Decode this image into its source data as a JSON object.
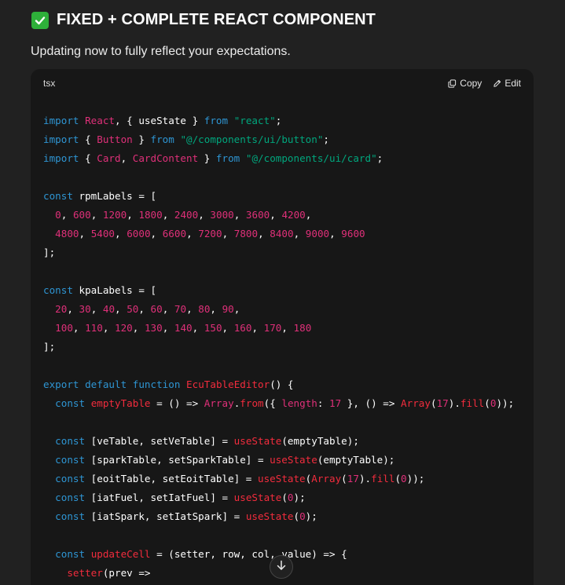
{
  "heading": {
    "emoji": "✅",
    "text": "FIXED + COMPLETE REACT COMPONENT"
  },
  "subtitle": "Updating now to fully reflect your expectations.",
  "code_block": {
    "language": "tsx",
    "copy_label": "Copy",
    "edit_label": "Edit",
    "lines": [
      [
        [
          "kw",
          "import"
        ],
        [
          "plain",
          " "
        ],
        [
          "id",
          "React"
        ],
        [
          "plain",
          ", { useState } "
        ],
        [
          "kw",
          "from"
        ],
        [
          "plain",
          " "
        ],
        [
          "str",
          "\"react\""
        ],
        [
          "plain",
          ";"
        ]
      ],
      [
        [
          "kw",
          "import"
        ],
        [
          "plain",
          " { "
        ],
        [
          "id",
          "Button"
        ],
        [
          "plain",
          " } "
        ],
        [
          "kw",
          "from"
        ],
        [
          "plain",
          " "
        ],
        [
          "str",
          "\"@/components/ui/button\""
        ],
        [
          "plain",
          ";"
        ]
      ],
      [
        [
          "kw",
          "import"
        ],
        [
          "plain",
          " { "
        ],
        [
          "id",
          "Card"
        ],
        [
          "plain",
          ", "
        ],
        [
          "id",
          "CardContent"
        ],
        [
          "plain",
          " } "
        ],
        [
          "kw",
          "from"
        ],
        [
          "plain",
          " "
        ],
        [
          "str",
          "\"@/components/ui/card\""
        ],
        [
          "plain",
          ";"
        ]
      ],
      [],
      [
        [
          "kw",
          "const"
        ],
        [
          "plain",
          " rpmLabels = ["
        ]
      ],
      [
        [
          "plain",
          "  "
        ],
        [
          "num",
          "0"
        ],
        [
          "plain",
          ", "
        ],
        [
          "num",
          "600"
        ],
        [
          "plain",
          ", "
        ],
        [
          "num",
          "1200"
        ],
        [
          "plain",
          ", "
        ],
        [
          "num",
          "1800"
        ],
        [
          "plain",
          ", "
        ],
        [
          "num",
          "2400"
        ],
        [
          "plain",
          ", "
        ],
        [
          "num",
          "3000"
        ],
        [
          "plain",
          ", "
        ],
        [
          "num",
          "3600"
        ],
        [
          "plain",
          ", "
        ],
        [
          "num",
          "4200"
        ],
        [
          "plain",
          ","
        ]
      ],
      [
        [
          "plain",
          "  "
        ],
        [
          "num",
          "4800"
        ],
        [
          "plain",
          ", "
        ],
        [
          "num",
          "5400"
        ],
        [
          "plain",
          ", "
        ],
        [
          "num",
          "6000"
        ],
        [
          "plain",
          ", "
        ],
        [
          "num",
          "6600"
        ],
        [
          "plain",
          ", "
        ],
        [
          "num",
          "7200"
        ],
        [
          "plain",
          ", "
        ],
        [
          "num",
          "7800"
        ],
        [
          "plain",
          ", "
        ],
        [
          "num",
          "8400"
        ],
        [
          "plain",
          ", "
        ],
        [
          "num",
          "9000"
        ],
        [
          "plain",
          ", "
        ],
        [
          "num",
          "9600"
        ]
      ],
      [
        [
          "plain",
          "];"
        ]
      ],
      [],
      [
        [
          "kw",
          "const"
        ],
        [
          "plain",
          " kpaLabels = ["
        ]
      ],
      [
        [
          "plain",
          "  "
        ],
        [
          "num",
          "20"
        ],
        [
          "plain",
          ", "
        ],
        [
          "num",
          "30"
        ],
        [
          "plain",
          ", "
        ],
        [
          "num",
          "40"
        ],
        [
          "plain",
          ", "
        ],
        [
          "num",
          "50"
        ],
        [
          "plain",
          ", "
        ],
        [
          "num",
          "60"
        ],
        [
          "plain",
          ", "
        ],
        [
          "num",
          "70"
        ],
        [
          "plain",
          ", "
        ],
        [
          "num",
          "80"
        ],
        [
          "plain",
          ", "
        ],
        [
          "num",
          "90"
        ],
        [
          "plain",
          ","
        ]
      ],
      [
        [
          "plain",
          "  "
        ],
        [
          "num",
          "100"
        ],
        [
          "plain",
          ", "
        ],
        [
          "num",
          "110"
        ],
        [
          "plain",
          ", "
        ],
        [
          "num",
          "120"
        ],
        [
          "plain",
          ", "
        ],
        [
          "num",
          "130"
        ],
        [
          "plain",
          ", "
        ],
        [
          "num",
          "140"
        ],
        [
          "plain",
          ", "
        ],
        [
          "num",
          "150"
        ],
        [
          "plain",
          ", "
        ],
        [
          "num",
          "160"
        ],
        [
          "plain",
          ", "
        ],
        [
          "num",
          "170"
        ],
        [
          "plain",
          ", "
        ],
        [
          "num",
          "180"
        ]
      ],
      [
        [
          "plain",
          "];"
        ]
      ],
      [],
      [
        [
          "kw",
          "export"
        ],
        [
          "plain",
          " "
        ],
        [
          "kw",
          "default"
        ],
        [
          "plain",
          " "
        ],
        [
          "kw",
          "function"
        ],
        [
          "plain",
          " "
        ],
        [
          "fn",
          "EcuTableEditor"
        ],
        [
          "plain",
          "() {"
        ]
      ],
      [
        [
          "plain",
          "  "
        ],
        [
          "kw",
          "const"
        ],
        [
          "plain",
          " "
        ],
        [
          "fn",
          "emptyTable"
        ],
        [
          "plain",
          " = () => "
        ],
        [
          "id",
          "Array"
        ],
        [
          "plain",
          "."
        ],
        [
          "fn",
          "from"
        ],
        [
          "plain",
          "({ "
        ],
        [
          "id",
          "length"
        ],
        [
          "plain",
          ": "
        ],
        [
          "num",
          "17"
        ],
        [
          "plain",
          " }, () => "
        ],
        [
          "fn",
          "Array"
        ],
        [
          "plain",
          "("
        ],
        [
          "num",
          "17"
        ],
        [
          "plain",
          ")."
        ],
        [
          "fn",
          "fill"
        ],
        [
          "plain",
          "("
        ],
        [
          "num",
          "0"
        ],
        [
          "plain",
          "));"
        ]
      ],
      [],
      [
        [
          "plain",
          "  "
        ],
        [
          "kw",
          "const"
        ],
        [
          "plain",
          " [veTable, setVeTable] = "
        ],
        [
          "fn",
          "useState"
        ],
        [
          "plain",
          "(emptyTable);"
        ]
      ],
      [
        [
          "plain",
          "  "
        ],
        [
          "kw",
          "const"
        ],
        [
          "plain",
          " [sparkTable, setSparkTable] = "
        ],
        [
          "fn",
          "useState"
        ],
        [
          "plain",
          "(emptyTable);"
        ]
      ],
      [
        [
          "plain",
          "  "
        ],
        [
          "kw",
          "const"
        ],
        [
          "plain",
          " [eoitTable, setEoitTable] = "
        ],
        [
          "fn",
          "useState"
        ],
        [
          "plain",
          "("
        ],
        [
          "fn",
          "Array"
        ],
        [
          "plain",
          "("
        ],
        [
          "num",
          "17"
        ],
        [
          "plain",
          ")."
        ],
        [
          "fn",
          "fill"
        ],
        [
          "plain",
          "("
        ],
        [
          "num",
          "0"
        ],
        [
          "plain",
          "));"
        ]
      ],
      [
        [
          "plain",
          "  "
        ],
        [
          "kw",
          "const"
        ],
        [
          "plain",
          " [iatFuel, setIatFuel] = "
        ],
        [
          "fn",
          "useState"
        ],
        [
          "plain",
          "("
        ],
        [
          "num",
          "0"
        ],
        [
          "plain",
          ");"
        ]
      ],
      [
        [
          "plain",
          "  "
        ],
        [
          "kw",
          "const"
        ],
        [
          "plain",
          " [iatSpark, setIatSpark] = "
        ],
        [
          "fn",
          "useState"
        ],
        [
          "plain",
          "("
        ],
        [
          "num",
          "0"
        ],
        [
          "plain",
          ");"
        ]
      ],
      [],
      [
        [
          "plain",
          "  "
        ],
        [
          "kw",
          "const"
        ],
        [
          "plain",
          " "
        ],
        [
          "fn",
          "updateCell"
        ],
        [
          "plain",
          " = (setter, row, col, value) => {"
        ]
      ],
      [
        [
          "plain",
          "    "
        ],
        [
          "fn",
          "setter"
        ],
        [
          "plain",
          "(prev =>"
        ]
      ]
    ]
  },
  "icons": {
    "heading": "check-mark-icon",
    "copy": "copy-icon",
    "edit": "pencil-icon",
    "scroll": "arrow-down-icon"
  },
  "colors": {
    "background": "#212121",
    "code_background": "#171717",
    "keyword": "#2e95d3",
    "string": "#00a67d",
    "number": "#df3079",
    "function": "#f22c3d",
    "check": "#2eb03a"
  }
}
